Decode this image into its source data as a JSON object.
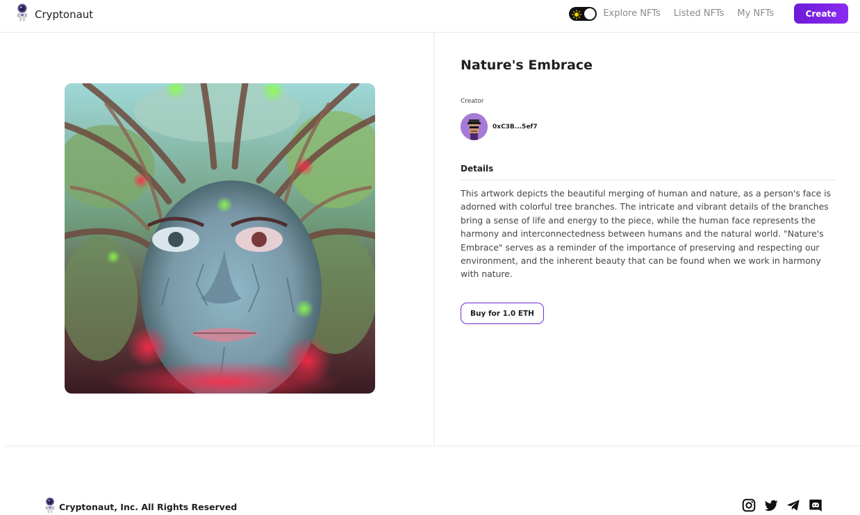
{
  "brand": {
    "name": "Cryptonaut",
    "logo_icon": "astronaut-icon"
  },
  "nav": {
    "links": [
      "Explore NFTs",
      "Listed NFTs",
      "My NFTs"
    ],
    "create_label": "Create",
    "theme_icon": "sun-icon"
  },
  "nft": {
    "title": "Nature's Embrace",
    "creator_label": "Creator",
    "creator_address": "0xC3B...5ef7",
    "details_heading": "Details",
    "description": "This artwork depicts the beautiful merging of human and nature, as a person's face is adorned with colorful tree branches. The intricate and vibrant details of the branches bring a sense of life and energy to the piece, while the human face represents the harmony and interconnectedness between humans and the natural world. \"Nature's Embrace\" serves as a reminder of the importance of preserving and respecting our environment, and the inherent beauty that can be found when we work in harmony with nature.",
    "buy_label": "Buy for 1.0 ETH"
  },
  "footer": {
    "copyright": "Cryptonaut, Inc. All Rights Reserved",
    "social_icons": [
      "instagram-icon",
      "twitter-icon",
      "telegram-icon",
      "discord-icon"
    ]
  },
  "colors": {
    "accent": "#6d1bd6",
    "accent_light": "#8a2bf0",
    "text": "#1f1f1f",
    "muted": "#8a8a8a",
    "border": "#e8e8e8"
  }
}
